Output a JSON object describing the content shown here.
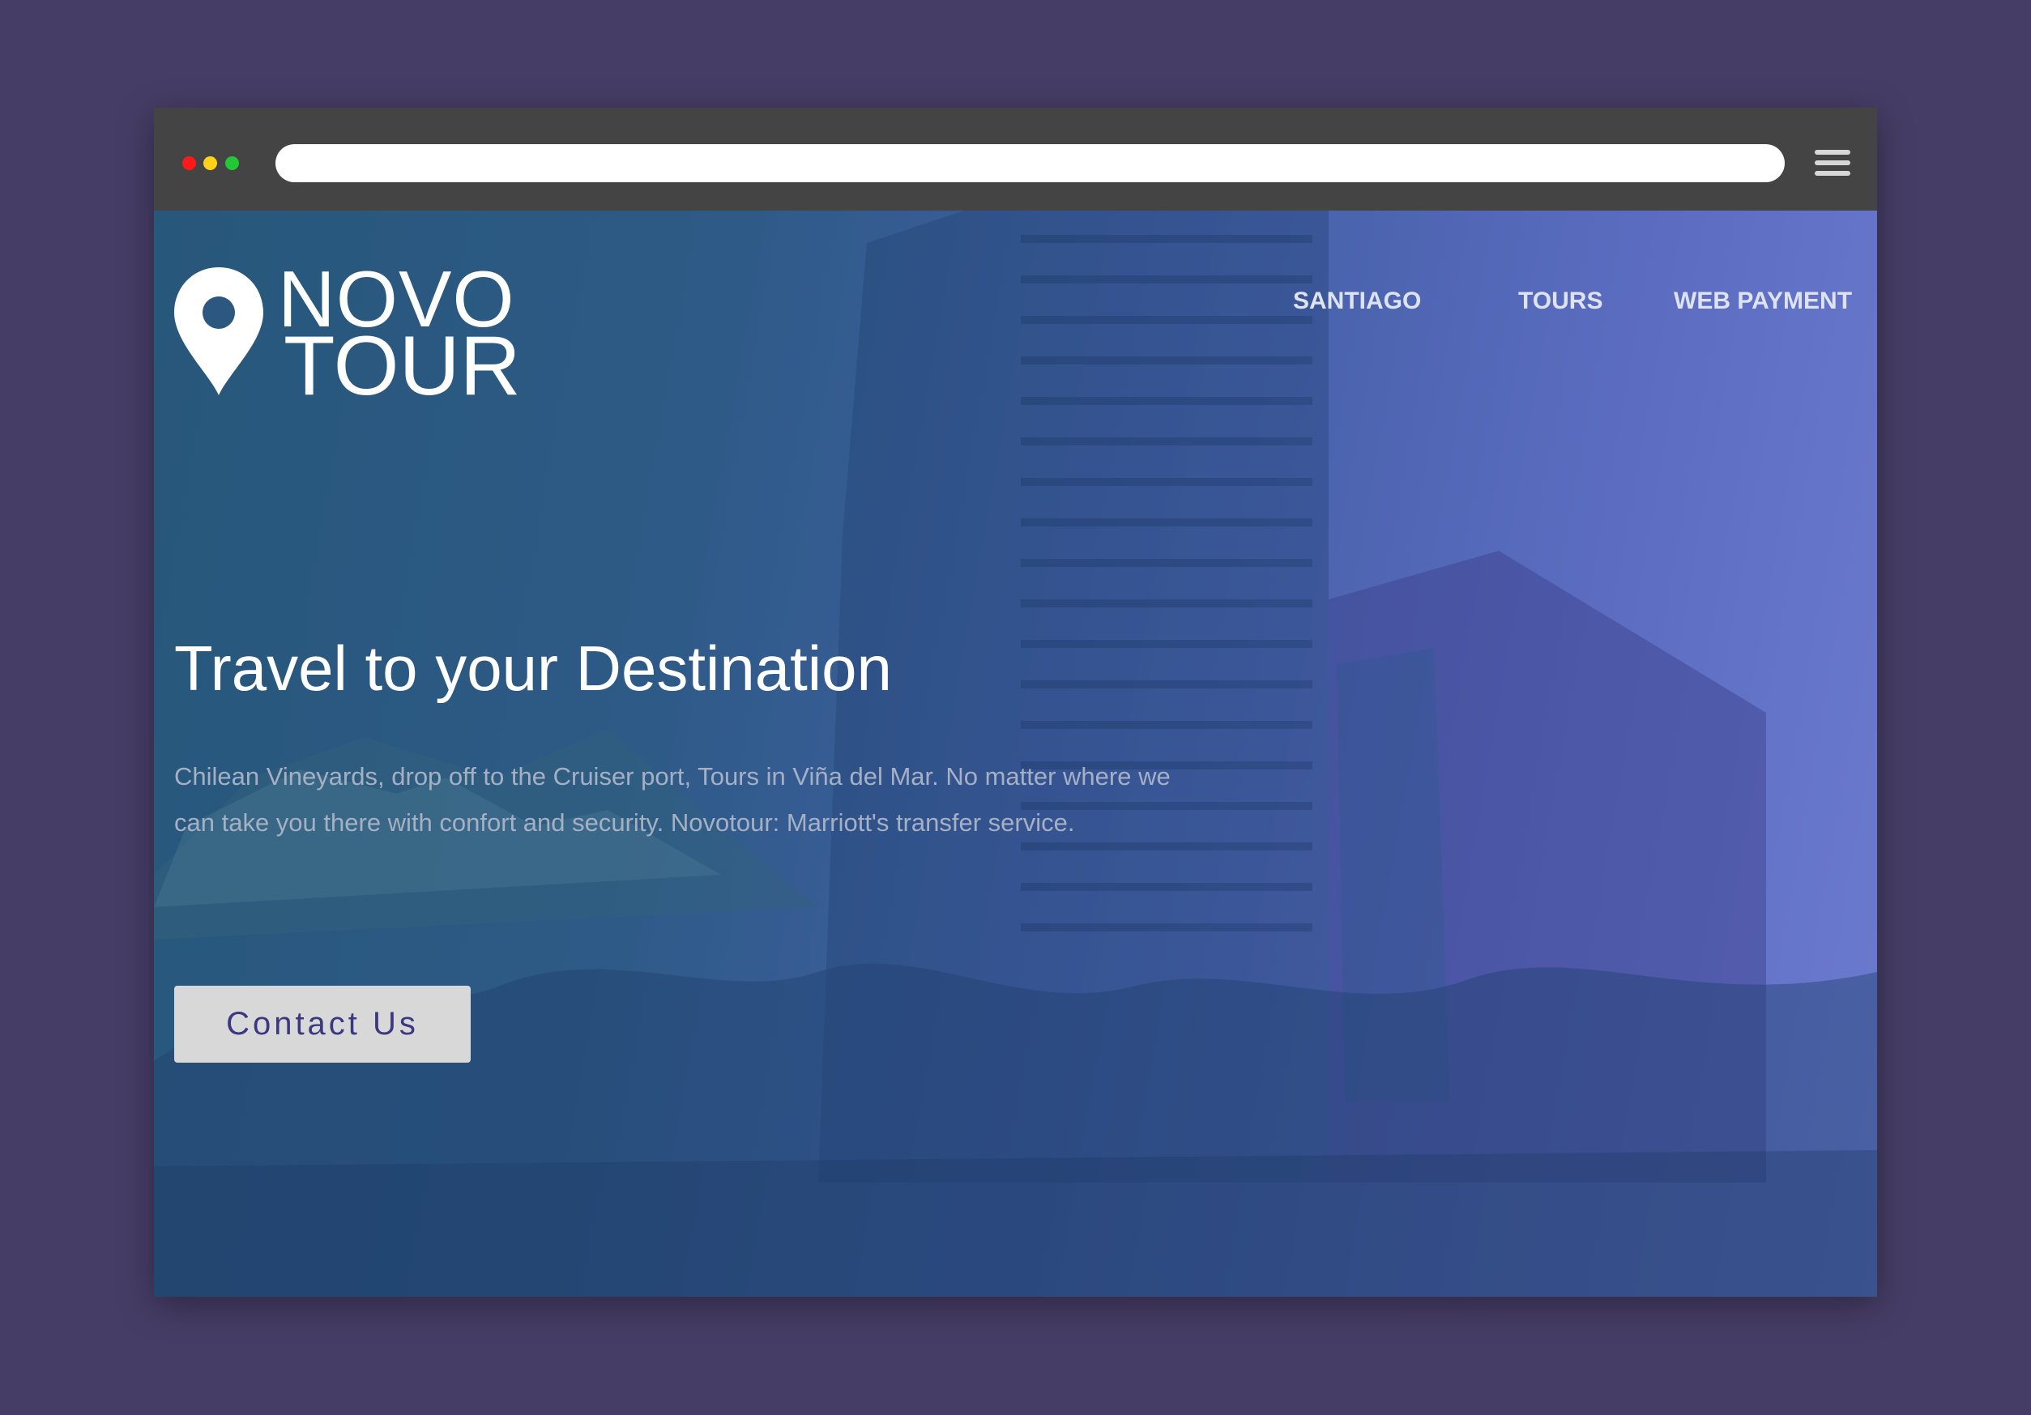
{
  "browser": {
    "traffic_lights": [
      "#ff1a1a",
      "#ffd21a",
      "#22c935"
    ],
    "url_value": "",
    "menu_icon": "hamburger-menu-icon"
  },
  "logo": {
    "icon": "map-pin-icon",
    "line1": "NOVO",
    "line2": "TOUR"
  },
  "nav": {
    "items": [
      {
        "label": "SANTIAGO"
      },
      {
        "label": "TOURS"
      },
      {
        "label": "WEB PAYMENT"
      }
    ]
  },
  "hero": {
    "headline": "Travel to your Destination",
    "description": "Chilean Vineyards, drop off to the Cruiser port, Tours in Viña del Mar. No matter where we can take you there with confort and security. Novotour: Marriott's transfer service.",
    "cta_label": "Contact Us"
  },
  "colors": {
    "page_background": "#463d66",
    "browser_chrome": "#444444",
    "hero_overlay_start": "#27577a",
    "hero_overlay_end": "#6c7bd0",
    "cta_background": "#d8d8d8",
    "cta_text": "#3a3880"
  }
}
